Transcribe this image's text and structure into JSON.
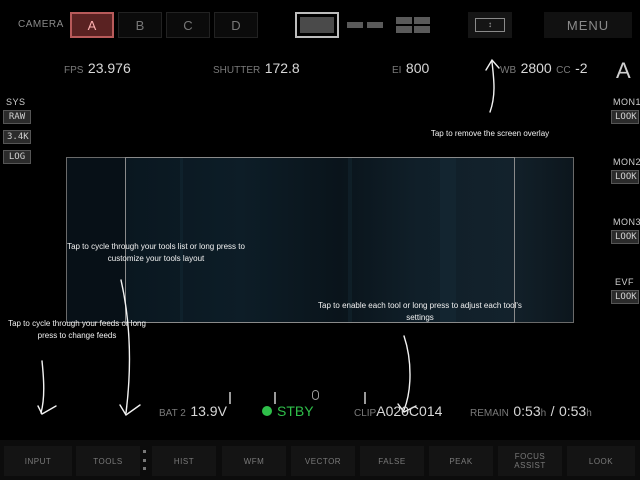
{
  "camera": {
    "label": "CAMERA",
    "buttons": [
      "A",
      "B",
      "C",
      "D"
    ],
    "active": "A"
  },
  "overlay_icon": "chevron-up-down-icon",
  "menu_label": "MENU",
  "readouts": {
    "fps_label": "FPS",
    "fps_value": "23.976",
    "shutter_label": "SHUTTER",
    "shutter_value": "172.8",
    "ei_label": "EI",
    "ei_value": "800",
    "wb_label": "WB",
    "wb_value": "2800",
    "cc_label": "CC",
    "cc_value": "-2",
    "camera_letter": "A"
  },
  "left_panel": {
    "sys_label": "SYS",
    "tags": [
      "RAW",
      "3.4K",
      "LOG"
    ]
  },
  "right_panel": [
    {
      "label": "MON1",
      "tag": "LOOK"
    },
    {
      "label": "MON2",
      "tag": "LOOK"
    },
    {
      "label": "MON3",
      "tag": "LOOK"
    },
    {
      "label": "EVF",
      "tag": "LOOK"
    }
  ],
  "annotations": {
    "overlay": "Tap to remove the screen overlay",
    "tools_list": "Tap to cycle through your tools list or long press to customize your tools layout",
    "tool_settings": "Tap to enable each tool or long press to adjust each tool's settings",
    "feeds": "Tap to cycle through your feeds or long press to change feeds"
  },
  "status": {
    "bat_label": "BAT 2",
    "bat_value": "13.9",
    "bat_unit": "V",
    "state": "STBY",
    "clip_label": "CLIP",
    "clip_value": "A020C014",
    "remain_label": "REMAIN",
    "remain_value1": "0:53",
    "remain_unit1": "h",
    "remain_sep": "/",
    "remain_value2": "0:53",
    "remain_unit2": "h"
  },
  "toolbar": {
    "input": "INPUT",
    "tools": "TOOLS",
    "items": [
      "HIST",
      "WFM",
      "VECTOR",
      "FALSE",
      "PEAK",
      "FOCUS ASSIST",
      "LOOK"
    ]
  },
  "colors": {
    "active_camera": "#5a2222",
    "standby": "#2fbf4a"
  }
}
